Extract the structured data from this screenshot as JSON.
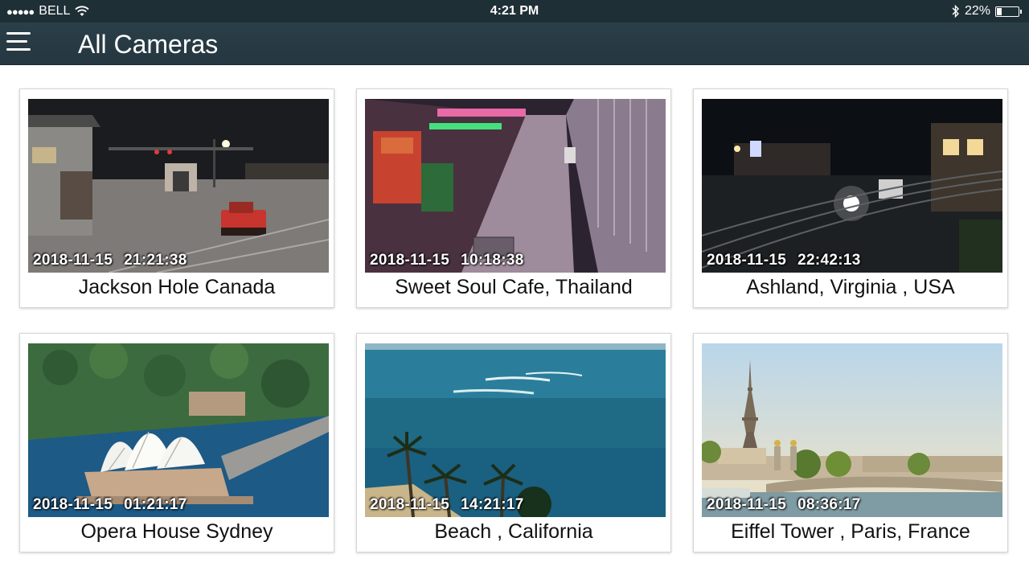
{
  "status_bar": {
    "signal": "●●●●●",
    "carrier": "BELL",
    "time": "4:21 PM",
    "battery_text": "22%",
    "battery_level": 0.22,
    "icons": [
      "wifi-icon",
      "bluetooth-icon",
      "battery-icon"
    ]
  },
  "app_bar": {
    "title": "All Cameras",
    "menu_icon": "hamburger-menu-icon"
  },
  "cameras": [
    {
      "name": "Jackson Hole Canada",
      "date": "2018-11-15",
      "time": "21:21:38",
      "scene": "night-street"
    },
    {
      "name": "Sweet Soul Cafe, Thailand",
      "date": "2018-11-15",
      "time": "10:18:38",
      "scene": "alley"
    },
    {
      "name": "Ashland, Virginia , USA",
      "date": "2018-11-15",
      "time": "22:42:13",
      "scene": "night-rail"
    },
    {
      "name": "Opera House Sydney",
      "date": "2018-11-15",
      "time": "01:21:17",
      "scene": "opera"
    },
    {
      "name": "Beach , California",
      "date": "2018-11-15",
      "time": "14:21:17",
      "scene": "beach"
    },
    {
      "name": "Eiffel Tower , Paris, France",
      "date": "2018-11-15",
      "time": "08:36:17",
      "scene": "paris"
    }
  ]
}
